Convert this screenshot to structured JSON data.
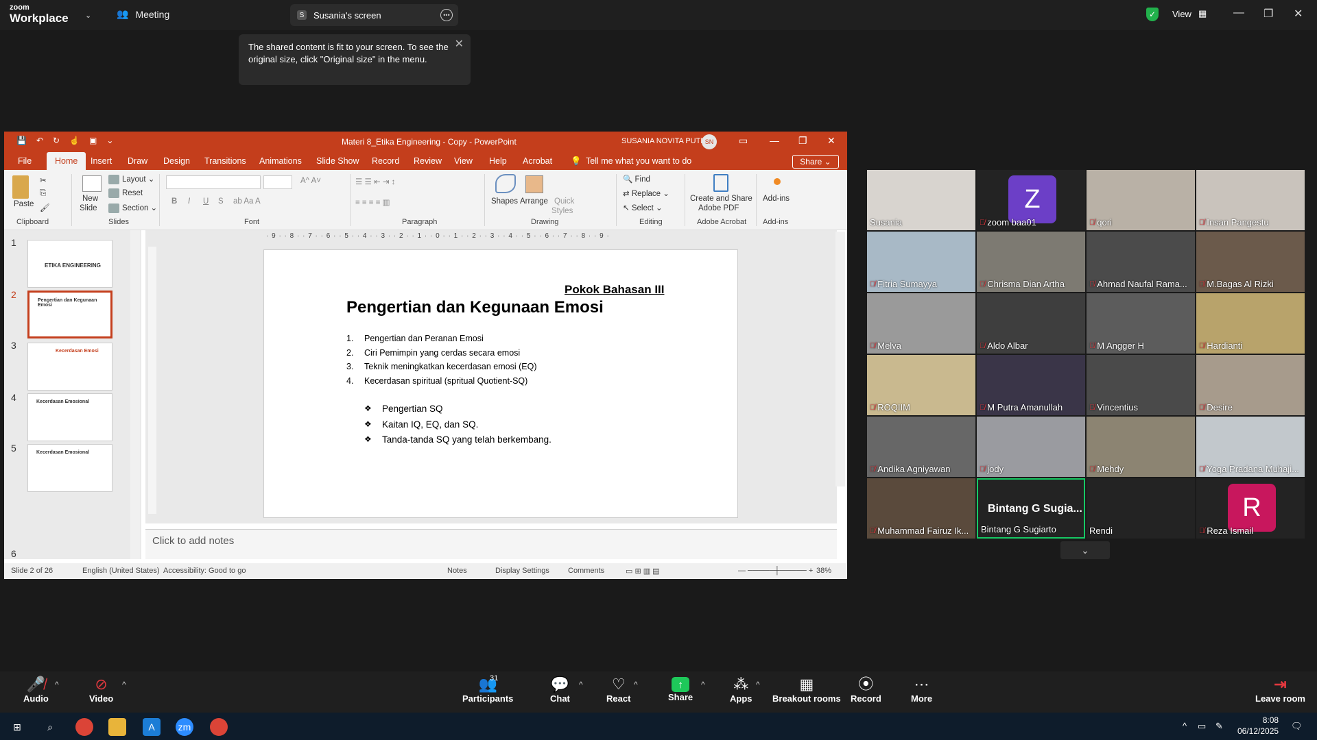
{
  "zoom": {
    "brand_line1": "zoom",
    "brand_line2": "Workplace",
    "meeting_label": "Meeting",
    "screen_badge": "S",
    "screen_tab": "Susania's screen",
    "view_label": "View",
    "tooltip": "The shared content is fit to your screen. To see the original size, click \"Original size\" in the menu."
  },
  "ppt": {
    "doc_title": "Materi 8_Etika Engineering - Copy - PowerPoint",
    "user_name": "SUSANIA NOVITA PUTRI",
    "user_initials": "SN",
    "tabs": [
      "File",
      "Home",
      "Insert",
      "Draw",
      "Design",
      "Transitions",
      "Animations",
      "Slide Show",
      "Record",
      "Review",
      "View",
      "Help",
      "Acrobat"
    ],
    "active_tab": "Home",
    "tell_me": "Tell me what you want to do",
    "share": "Share",
    "ribbon": {
      "paste": "Paste",
      "new_slide_1": "New",
      "new_slide_2": "Slide",
      "layout": "Layout",
      "reset": "Reset",
      "section": "Section",
      "shapes": "Shapes",
      "arrange": "Arrange",
      "quick_styles_1": "Quick",
      "quick_styles_2": "Styles",
      "find": "Find",
      "replace": "Replace",
      "select": "Select",
      "adobe_1": "Create and Share",
      "adobe_2": "Adobe PDF",
      "addins": "Add-ins",
      "groups": [
        "Clipboard",
        "Slides",
        "Font",
        "Paragraph",
        "Drawing",
        "Editing",
        "Adobe Acrobat",
        "Add-ins"
      ]
    },
    "thumbs": [
      {
        "num": "1",
        "text": "ETIKA ENGINEERING"
      },
      {
        "num": "2",
        "text": "Pengertian dan Kegunaan Emosi"
      },
      {
        "num": "3",
        "text": "Kecerdasan Emosi"
      },
      {
        "num": "4",
        "text": "Kecerdasan Emosional"
      },
      {
        "num": "5",
        "text": "Kecerdasan Emosional"
      },
      {
        "num": "6",
        "text": ""
      }
    ],
    "ruler_h": "· 9 · · 8 · · 7 · · 6 · · 5 · · 4 · · 3 · · 2 · · 1 · · 0 · · 1 · · 2 · · 3 · · 4 · · 5 · · 6 · · 7 · · 8 · · 9 ·",
    "slide": {
      "subtitle": "Pokok Bahasan III",
      "title": "Pengertian dan Kegunaan Emosi",
      "numbered": [
        {
          "n": "1.",
          "text": "Pengertian dan Peranan Emosi"
        },
        {
          "n": "2.",
          "text": "Ciri Pemimpin yang cerdas secara emosi"
        },
        {
          "n": "3.",
          "text": "Teknik meningkatkan kecerdasan emosi (EQ)"
        },
        {
          "n": "4.",
          "text": "Kecerdasan spiritual (spritual Quotient-SQ)"
        }
      ],
      "bullet": "❖",
      "bullets": [
        "Pengertian SQ",
        "Kaitan IQ, EQ, dan SQ.",
        "Tanda-tanda SQ yang telah berkembang."
      ]
    },
    "notes_placeholder": "Click to add notes",
    "status": {
      "slide": "Slide 2 of 26",
      "language": "English (United States)",
      "accessibility": "Accessibility: Good to go",
      "notes": "Notes",
      "display": "Display Settings",
      "comments": "Comments",
      "zoom": "38%"
    }
  },
  "participants": [
    {
      "name": "Susania",
      "muted": false,
      "bg": "#d8d4cf",
      "letter": "",
      "lcolor": ""
    },
    {
      "name": "zoom baa01",
      "muted": true,
      "bg": "#232323",
      "letter": "Z",
      "lcolor": "#6c3fc7"
    },
    {
      "name": "qori",
      "muted": true,
      "bg": "#b9b1a6",
      "letter": "",
      "lcolor": ""
    },
    {
      "name": "Insan Pangestu",
      "muted": true,
      "bg": "#c9c3bc",
      "letter": "",
      "lcolor": ""
    },
    {
      "name": "Fitria Sumayya",
      "muted": true,
      "bg": "#a8b9c6",
      "letter": "",
      "lcolor": ""
    },
    {
      "name": "Chrisma Dian Artha",
      "muted": true,
      "bg": "#7d7a72",
      "letter": "",
      "lcolor": ""
    },
    {
      "name": "Ahmad Naufal Rama...",
      "muted": true,
      "bg": "#4b4b4b",
      "letter": "",
      "lcolor": ""
    },
    {
      "name": "M.Bagas Al Rizki",
      "muted": true,
      "bg": "#6b5a4b",
      "letter": "",
      "lcolor": ""
    },
    {
      "name": "Melva",
      "muted": true,
      "bg": "#9a9a9a",
      "letter": "",
      "lcolor": ""
    },
    {
      "name": "Aldo Albar",
      "muted": true,
      "bg": "#3e3e3e",
      "letter": "",
      "lcolor": ""
    },
    {
      "name": "M Angger H",
      "muted": true,
      "bg": "#5c5c5c",
      "letter": "",
      "lcolor": ""
    },
    {
      "name": "Hardianti",
      "muted": true,
      "bg": "#b8a36b",
      "letter": "",
      "lcolor": ""
    },
    {
      "name": "ROQIIM",
      "muted": true,
      "bg": "#c9b98f",
      "letter": "",
      "lcolor": ""
    },
    {
      "name": "M Putra Amanullah",
      "muted": true,
      "bg": "#3a3548",
      "letter": "",
      "lcolor": ""
    },
    {
      "name": "Vincentius",
      "muted": true,
      "bg": "#4a4a4a",
      "letter": "",
      "lcolor": ""
    },
    {
      "name": "Desire",
      "muted": true,
      "bg": "#a79b8c",
      "letter": "",
      "lcolor": ""
    },
    {
      "name": "Andika Agniyawan",
      "muted": true,
      "bg": "#676767",
      "letter": "",
      "lcolor": ""
    },
    {
      "name": "jody",
      "muted": true,
      "bg": "#9a9ba0",
      "letter": "",
      "lcolor": ""
    },
    {
      "name": "Mehdy",
      "muted": true,
      "bg": "#8c8472",
      "letter": "",
      "lcolor": ""
    },
    {
      "name": "Yoga Pradana Muhaji...",
      "muted": true,
      "bg": "#c2c8cc",
      "letter": "",
      "lcolor": ""
    },
    {
      "name": "Muhammad Fairuz Ik...",
      "muted": true,
      "bg": "#5a4a3c",
      "letter": "",
      "lcolor": ""
    },
    {
      "name": "Bintang G Sugiarto",
      "muted": false,
      "bg": "#232323",
      "letter": "",
      "lcolor": "",
      "big": "Bintang G Sugia...",
      "active": true
    },
    {
      "name": "Rendi",
      "muted": false,
      "bg": "#232323",
      "letter": "",
      "lcolor": ""
    },
    {
      "name": "Reza Ismail",
      "muted": true,
      "bg": "#232323",
      "letter": "R",
      "lcolor": "#c8175d"
    }
  ],
  "toolbar": {
    "audio": "Audio",
    "video": "Video",
    "participants": "Participants",
    "participant_count": "31",
    "chat": "Chat",
    "react": "React",
    "share": "Share",
    "apps": "Apps",
    "breakout": "Breakout rooms",
    "record": "Record",
    "more": "More",
    "leave": "Leave room"
  },
  "taskbar": {
    "time": "8:08",
    "date": "06/12/2025"
  }
}
